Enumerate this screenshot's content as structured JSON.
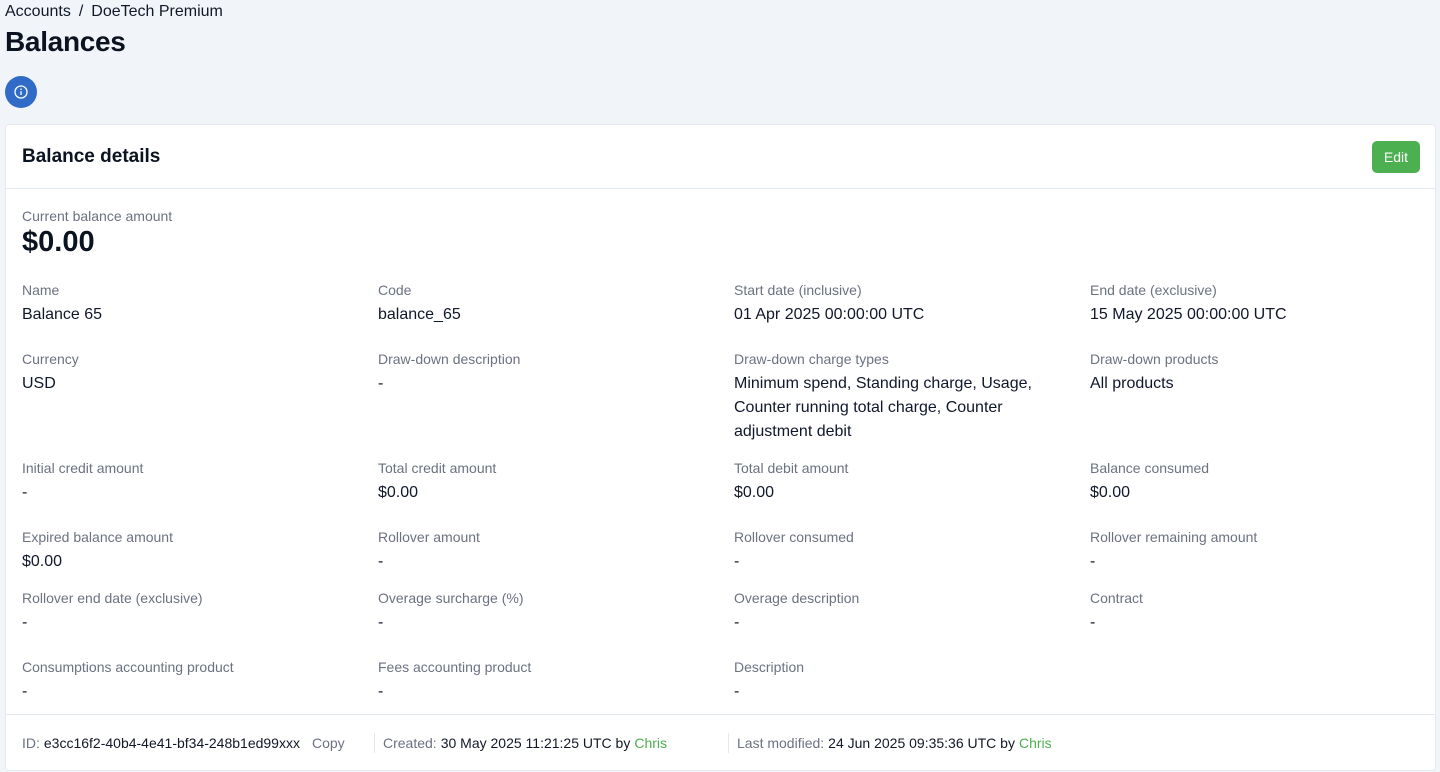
{
  "breadcrumb": {
    "accounts": "Accounts",
    "separator": "/",
    "account": "DoeTech Premium"
  },
  "page_title": "Balances",
  "info_icon": "info-icon",
  "card": {
    "title": "Balance details",
    "edit_label": "Edit",
    "current_balance_label": "Current balance amount",
    "current_balance_value": "$0.00",
    "fields": {
      "name": {
        "label": "Name",
        "value": "Balance 65"
      },
      "code": {
        "label": "Code",
        "value": "balance_65"
      },
      "start_date": {
        "label": "Start date (inclusive)",
        "value": "01 Apr 2025 00:00:00 UTC"
      },
      "end_date": {
        "label": "End date (exclusive)",
        "value": "15 May 2025 00:00:00 UTC"
      },
      "currency": {
        "label": "Currency",
        "value": "USD"
      },
      "drawdown_description": {
        "label": "Draw-down description",
        "value": "-"
      },
      "drawdown_charge_types": {
        "label": "Draw-down charge types",
        "value": "Minimum spend, Standing charge, Usage, Counter running total charge, Counter adjustment debit"
      },
      "drawdown_products": {
        "label": "Draw-down products",
        "value": "All products"
      },
      "initial_credit": {
        "label": "Initial credit amount",
        "value": "-"
      },
      "total_credit": {
        "label": "Total credit amount",
        "value": "$0.00"
      },
      "total_debit": {
        "label": "Total debit amount",
        "value": "$0.00"
      },
      "balance_consumed": {
        "label": "Balance consumed",
        "value": "$0.00"
      },
      "expired_balance": {
        "label": "Expired balance amount",
        "value": "$0.00"
      },
      "rollover_amount": {
        "label": "Rollover amount",
        "value": "-"
      },
      "rollover_consumed": {
        "label": "Rollover consumed",
        "value": "-"
      },
      "rollover_remaining": {
        "label": "Rollover remaining amount",
        "value": "-"
      },
      "rollover_end_date": {
        "label": "Rollover end date (exclusive)",
        "value": "-"
      },
      "overage_surcharge": {
        "label": "Overage surcharge (%)",
        "value": "-"
      },
      "overage_description": {
        "label": "Overage description",
        "value": "-"
      },
      "contract": {
        "label": "Contract",
        "value": "-"
      },
      "consumptions_product": {
        "label": "Consumptions accounting product",
        "value": "-"
      },
      "fees_product": {
        "label": "Fees accounting product",
        "value": "-"
      },
      "description": {
        "label": "Description",
        "value": "-"
      }
    },
    "footer": {
      "id_label": "ID:",
      "id_value": "e3cc16f2-40b4-4e41-bf34-248b1ed99xxx",
      "copy_label": "Copy",
      "created_label": "Created:",
      "created_value": "30 May 2025 11:21:25 UTC by",
      "created_by": "Chris",
      "modified_label": "Last modified:",
      "modified_value": "24 Jun 2025 09:35:36 UTC by",
      "modified_by": "Chris"
    }
  },
  "colors": {
    "accent_green": "#4caf50",
    "info_blue": "#2f6bc7",
    "background": "#f1f4f9"
  }
}
